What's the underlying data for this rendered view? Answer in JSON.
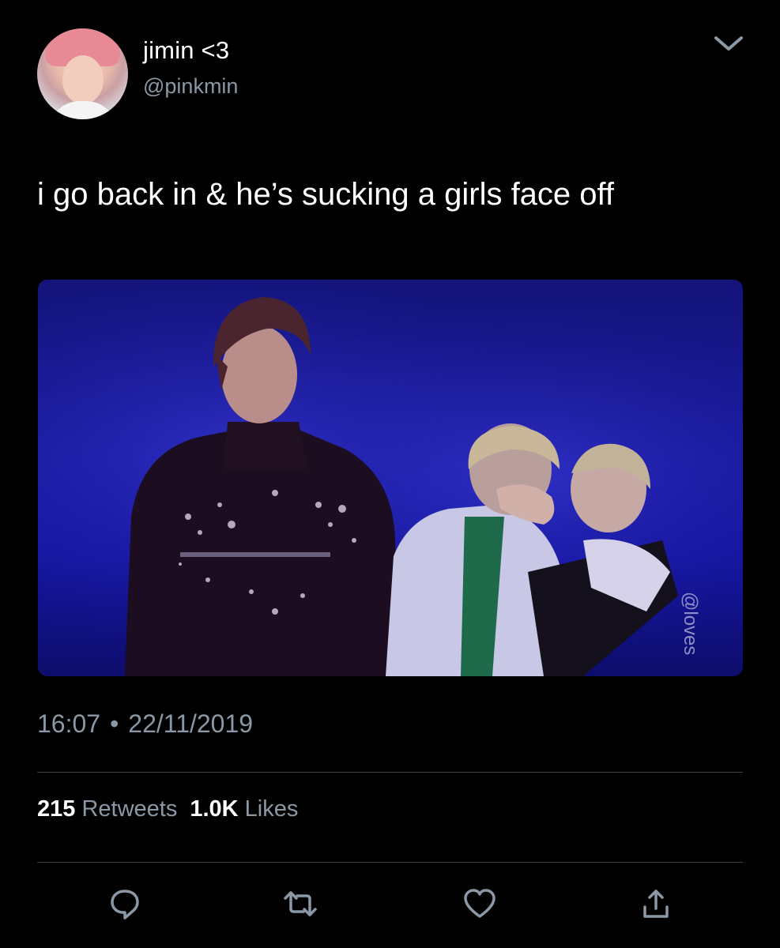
{
  "user": {
    "display_name": "jimin <3",
    "handle": "@pinkmin",
    "avatar": "avatar-photo"
  },
  "tweet": {
    "text": "i go back in & he’s sucking a girls face off",
    "time": "16:07",
    "separator": "•",
    "date": "22/11/2019"
  },
  "media": {
    "watermark": "@loves"
  },
  "stats": {
    "retweets_count": "215",
    "retweets_label": "Retweets",
    "likes_count": "1.0K",
    "likes_label": "Likes"
  },
  "icons": {
    "menu": "chevron-down-icon",
    "reply": "reply-icon",
    "retweet": "retweet-icon",
    "like": "heart-icon",
    "share": "share-icon"
  },
  "colors": {
    "background": "#000000",
    "text_primary": "#ffffff",
    "text_secondary": "#8b98a5",
    "divider": "#38444d"
  }
}
